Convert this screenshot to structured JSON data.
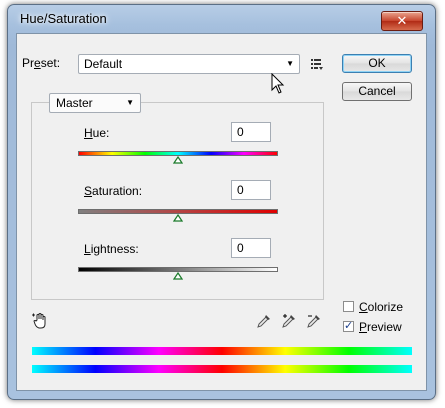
{
  "window": {
    "title": "Hue/Saturation",
    "close_glyph": "✕"
  },
  "preset": {
    "label_pre": "Pr",
    "label_accel": "e",
    "label_post": "set:",
    "value": "Default",
    "menu_icon": "preset-options-icon"
  },
  "buttons": {
    "ok": "OK",
    "reset": "Cancel"
  },
  "channel": {
    "value": "Master"
  },
  "sliders": {
    "hue": {
      "accel": "H",
      "rest": "ue:",
      "value": "0",
      "level": 0.5
    },
    "saturation": {
      "accel": "S",
      "rest": "aturation:",
      "value": "0",
      "level": 0.5
    },
    "lightness": {
      "accel": "L",
      "rest": "ightness:",
      "value": "0",
      "level": 0.5
    }
  },
  "options": {
    "colorize": {
      "accel": "C",
      "rest": "olorize",
      "checked": false
    },
    "preview": {
      "accel": "P",
      "rest": "review",
      "checked": true
    }
  },
  "icons": [
    "targeted-adjustment-hand-icon",
    "eyedropper-icon",
    "eyedropper-plus-icon",
    "eyedropper-minus-icon"
  ]
}
